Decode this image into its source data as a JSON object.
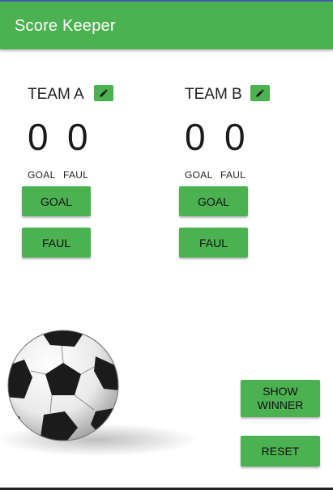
{
  "app_bar": {
    "title": "Score Keeper",
    "color": "#4cb151"
  },
  "teams": [
    {
      "name": "TEAM A",
      "goals": "0",
      "fauls": "0",
      "goal_label": "GOAL",
      "faul_label": "FAUL",
      "goal_button": "GOAL",
      "faul_button": "FAUL",
      "edit_icon": "pencil-icon"
    },
    {
      "name": "TEAM B",
      "goals": "0",
      "fauls": "0",
      "goal_label": "GOAL",
      "faul_label": "FAUL",
      "goal_button": "GOAL",
      "faul_button": "FAUL",
      "edit_icon": "pencil-icon"
    }
  ],
  "actions": {
    "show_winner": "SHOW WINNER",
    "reset": "RESET"
  },
  "decor": {
    "image": "soccer-ball"
  }
}
